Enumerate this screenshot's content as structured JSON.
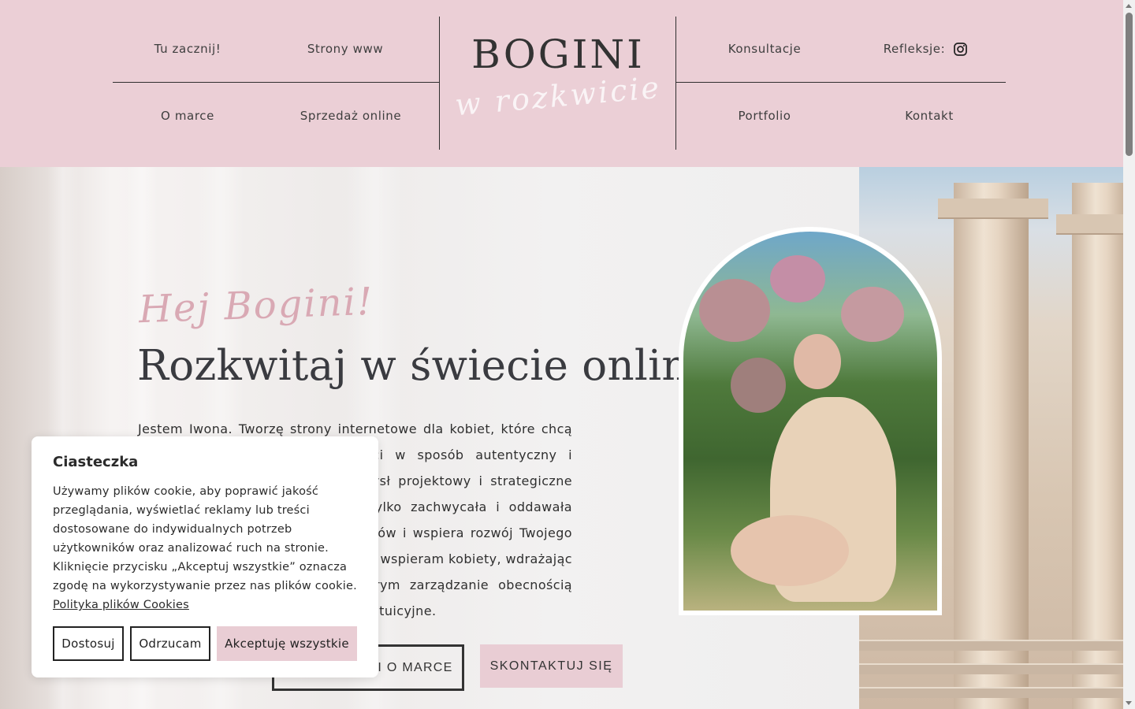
{
  "header": {
    "nav_left_top": [
      "Tu zacznij!",
      "Strony www"
    ],
    "nav_left_bottom": [
      "O marce",
      "Sprzedaż online"
    ],
    "nav_right_top": [
      "Konsultacje",
      "Refleksje:"
    ],
    "nav_right_bottom": [
      "Portfolio",
      "Kontakt"
    ],
    "logo_main": "BOGINI",
    "logo_sub": "w rozkwicie",
    "social_icon": "instagram-icon",
    "background_color": "#ebcfd6"
  },
  "hero": {
    "greeting": "Hej Bogini!",
    "headline": "Rozkwitaj w świecie online",
    "intro": "Jestem Iwona. Tworzę strony internetowe dla kobiet, które chcą budować swoją obecność w sieci w sposób autentyczny i profesjonalny. Łączę estetykę, zmysł projektowy i strategiczne myślenie, aby Twoja strona nie tylko zachwycała i oddawała Ciebie, przyciąga właściwych klientów i wspiera rozwój Twojego biznesu. Poza projektowaniem stron wspieram kobiety, wdrażając skuteczne rozwiązania, dzięki którym zarządzanie obecnością online staje się prostsze i bardziej intuicyjne.",
    "button_outline": "DOWIEDZ SIĘ WIĘCEJ O MNIE I O MARCE",
    "button_outline_visible": "I O MARCE",
    "button_pink": "SKONTAKTUJ SIĘ",
    "accent_color": "#e9cdd4"
  },
  "cookie": {
    "title": "Ciasteczka",
    "text": "Używamy plików cookie, aby poprawić jakość przeglądania, wyświetlać reklamy lub treści dostosowane do indywidualnych potrzeb użytkowników oraz analizować ruch na stronie. Kliknięcie przycisku „Akceptuj wszystkie” oznacza zgodę na wykorzystywanie przez nas plików cookie.",
    "link": "Polityka plików Cookies",
    "buttons": [
      "Dostosuj",
      "Odrzucam",
      "Akceptuję wszystkie"
    ]
  }
}
